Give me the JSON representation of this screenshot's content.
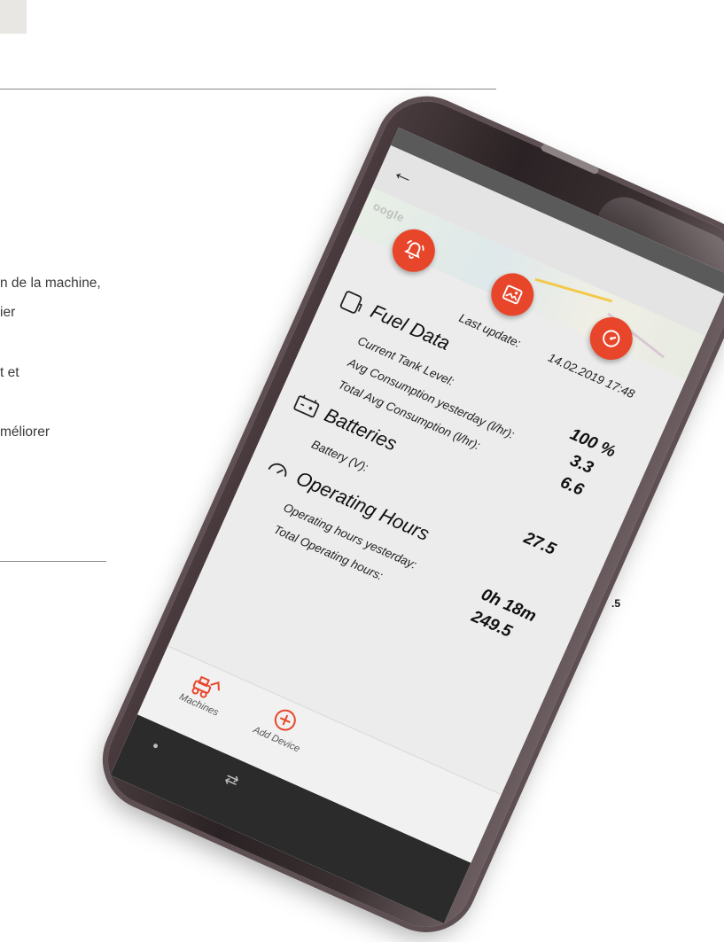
{
  "background_page": {
    "lines": [
      "n de la machine,",
      "ier",
      "t et",
      "méliorer"
    ],
    "page_number": ".5"
  },
  "phone": {
    "header": {
      "back_icon": "arrow-left-icon",
      "map_logo_text": "oogle"
    },
    "action_buttons": [
      {
        "icon": "alarm-bell-icon",
        "color": "#e8462b"
      },
      {
        "icon": "image-icon",
        "color": "#e8462b"
      },
      {
        "icon": "gauge-icon",
        "color": "#e8462b"
      }
    ],
    "last_update": {
      "label": "Last update:",
      "value": "14.02.2019 17:48"
    },
    "fuel": {
      "title": "Fuel Data",
      "icon": "fuel-tank-icon",
      "rows": [
        {
          "label": "Current Tank Level:",
          "value": "100 %"
        },
        {
          "label": "Avg Consumption yesterday (l/hr):",
          "value": "3.3"
        },
        {
          "label": "Total Avg Consumption (l/hr):",
          "value": "6.6"
        }
      ]
    },
    "batteries": {
      "title": "Batteries",
      "icon": "battery-icon",
      "rows": [
        {
          "label": "Battery (V):",
          "value": "27.5"
        }
      ]
    },
    "operating": {
      "title": "Operating Hours",
      "icon": "speedometer-icon",
      "rows": [
        {
          "label": "Operating hours yesterday:",
          "value": "0h 18m"
        },
        {
          "label": "Total Operating hours:",
          "value": "249.5"
        }
      ]
    },
    "bottom_nav": [
      {
        "label": "Machines",
        "icon": "excavator-icon"
      },
      {
        "label": "Add Device",
        "icon": "plus-circle-icon"
      }
    ],
    "accent_color": "#e8462b"
  }
}
